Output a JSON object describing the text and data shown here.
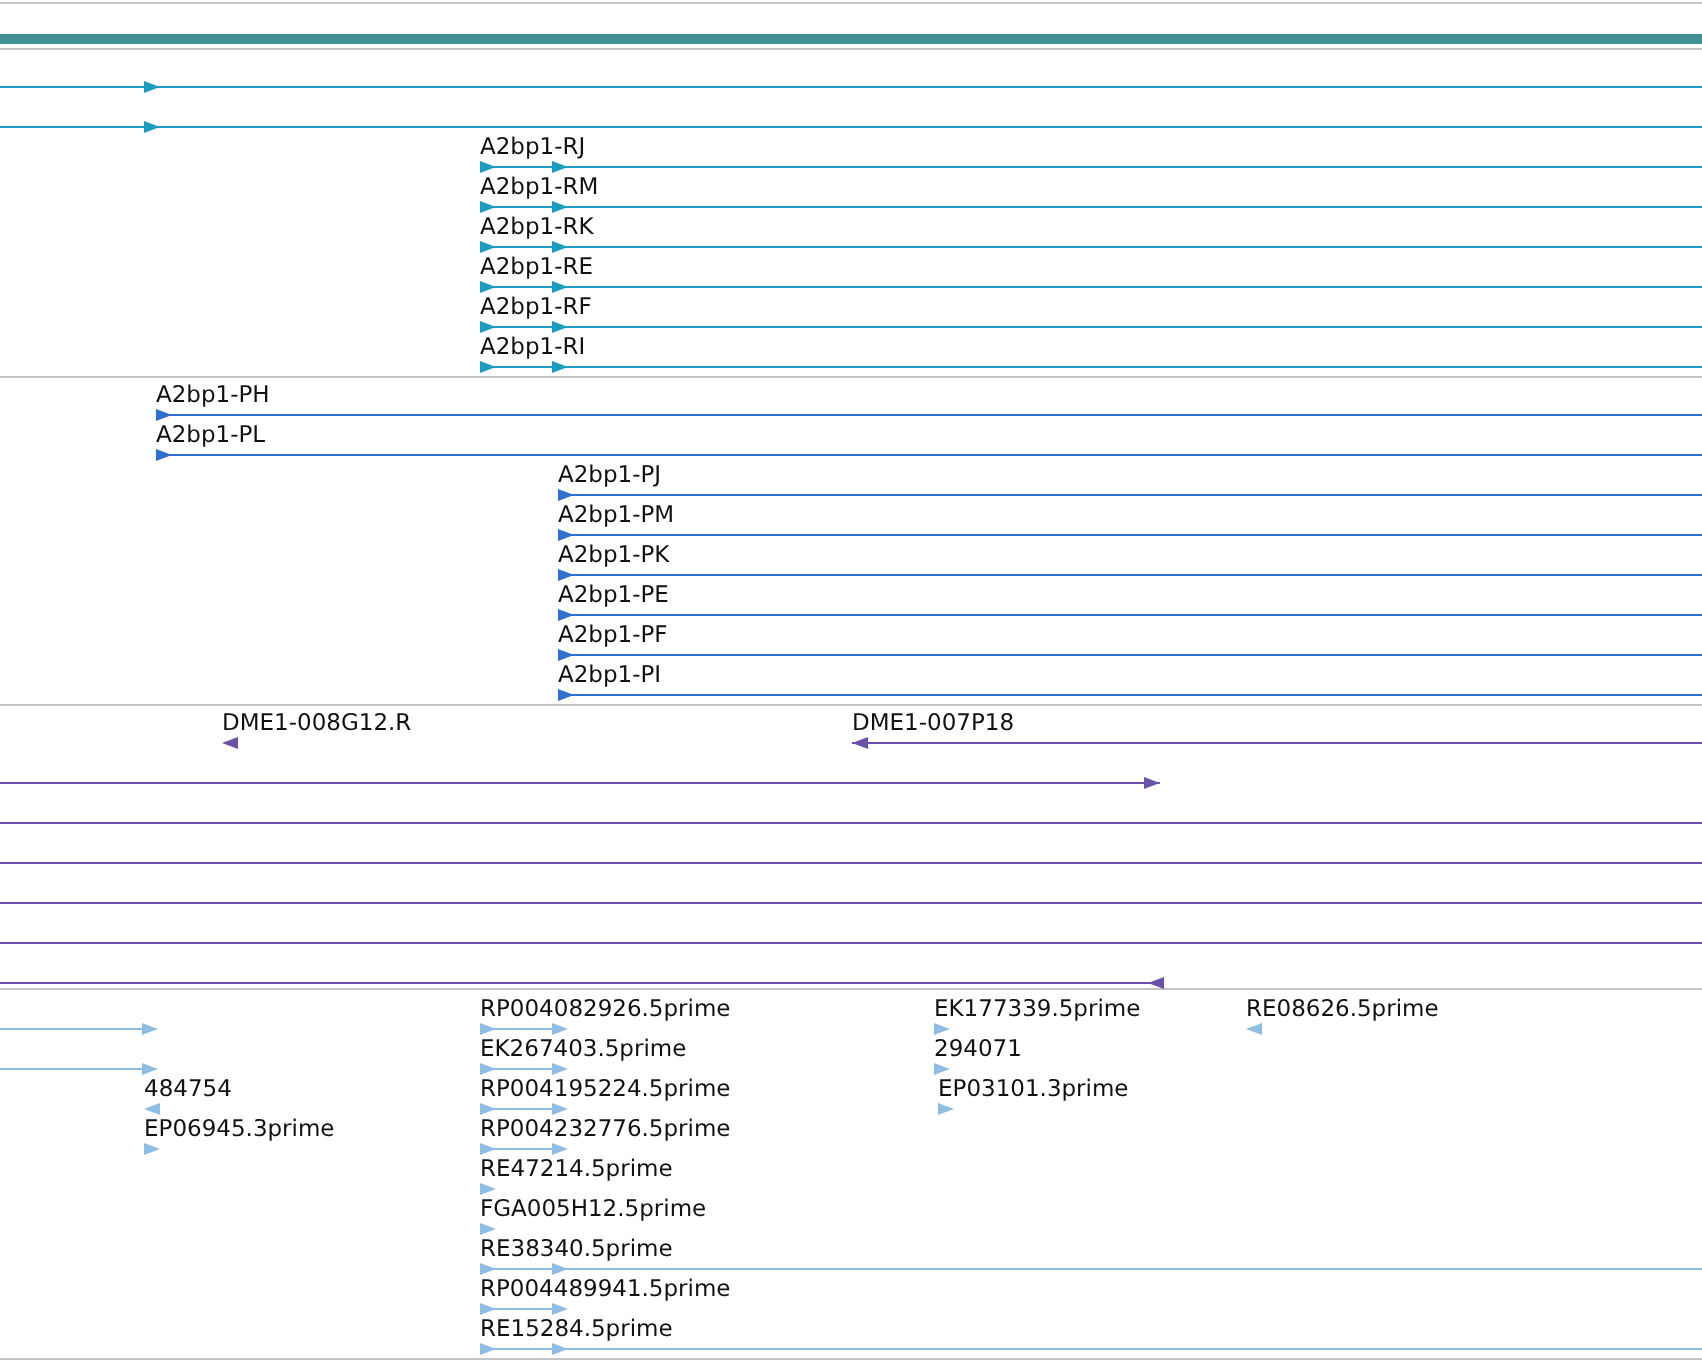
{
  "tracks": [
    {
      "color": "#1b9bbf",
      "features": [
        {
          "kind": "stranded",
          "reverse": false
        },
        {
          "kind": "stranded",
          "reverse": false
        },
        {
          "label": "A2bp1-RJ",
          "kind": "stranded",
          "reverse": false
        },
        {
          "label": "A2bp1-RM",
          "kind": "stranded",
          "reverse": false
        },
        {
          "label": "A2bp1-RK",
          "kind": "stranded",
          "reverse": false
        },
        {
          "label": "A2bp1-RE",
          "kind": "stranded",
          "reverse": false
        },
        {
          "label": "A2bp1-RF",
          "kind": "stranded",
          "reverse": false
        },
        {
          "label": "A2bp1-RI",
          "kind": "stranded",
          "reverse": false
        }
      ]
    },
    {
      "color": "#2f6fcf",
      "features": [
        {
          "label": "A2bp1-PH",
          "kind": "stranded",
          "reverse": false
        },
        {
          "label": "A2bp1-PL",
          "kind": "stranded",
          "reverse": false
        },
        {
          "label": "A2bp1-PJ",
          "kind": "stranded",
          "reverse": false
        },
        {
          "label": "A2bp1-PM",
          "kind": "stranded",
          "reverse": false
        },
        {
          "label": "A2bp1-PK",
          "kind": "stranded",
          "reverse": false
        },
        {
          "label": "A2bp1-PE",
          "kind": "stranded",
          "reverse": false
        },
        {
          "label": "A2bp1-PF",
          "kind": "stranded",
          "reverse": false
        },
        {
          "label": "A2bp1-PI",
          "kind": "stranded",
          "reverse": false
        }
      ]
    },
    {
      "color": "#6b51a8",
      "features": [
        {
          "label": "DME1-008G12.R",
          "kind": "stranded",
          "reverse": true
        },
        {
          "label": "DME1-007P18",
          "kind": "stranded",
          "reverse": true
        },
        {
          "kind": "stranded",
          "reverse": false
        },
        {
          "kind": "unstranded"
        },
        {
          "kind": "unstranded"
        },
        {
          "kind": "unstranded"
        },
        {
          "kind": "unstranded"
        },
        {
          "kind": "stranded",
          "reverse": true
        }
      ]
    },
    {
      "color": "#8dbde3",
      "features": [
        {
          "kind": "stranded",
          "reverse": false
        },
        {
          "kind": "stranded",
          "reverse": false
        },
        {
          "label": "484754",
          "kind": "stranded",
          "reverse": true
        },
        {
          "label": "EP06945.3prime",
          "kind": "stranded",
          "reverse": false
        },
        {
          "label": "RP004082926.5prime",
          "kind": "stranded",
          "reverse": false
        },
        {
          "label": "EK267403.5prime",
          "kind": "stranded",
          "reverse": false
        },
        {
          "label": "RP004195224.5prime",
          "kind": "stranded",
          "reverse": false
        },
        {
          "label": "RP004232776.5prime",
          "kind": "stranded",
          "reverse": false
        },
        {
          "label": "RE47214.5prime",
          "kind": "stranded",
          "reverse": false
        },
        {
          "label": "FGA005H12.5prime",
          "kind": "stranded",
          "reverse": false
        },
        {
          "label": "RE38340.5prime",
          "kind": "stranded",
          "reverse": false
        },
        {
          "label": "RP004489941.5prime",
          "kind": "stranded",
          "reverse": false
        },
        {
          "label": "RE15284.5prime",
          "kind": "stranded",
          "reverse": false
        },
        {
          "label": "EK177339.5prime",
          "kind": "stranded",
          "reverse": false
        },
        {
          "label": "294071",
          "kind": "stranded",
          "reverse": false
        },
        {
          "label": "EP03101.3prime",
          "kind": "stranded",
          "reverse": false
        },
        {
          "label": "RE08626.5prime",
          "kind": "stranded",
          "reverse": true
        }
      ]
    }
  ]
}
